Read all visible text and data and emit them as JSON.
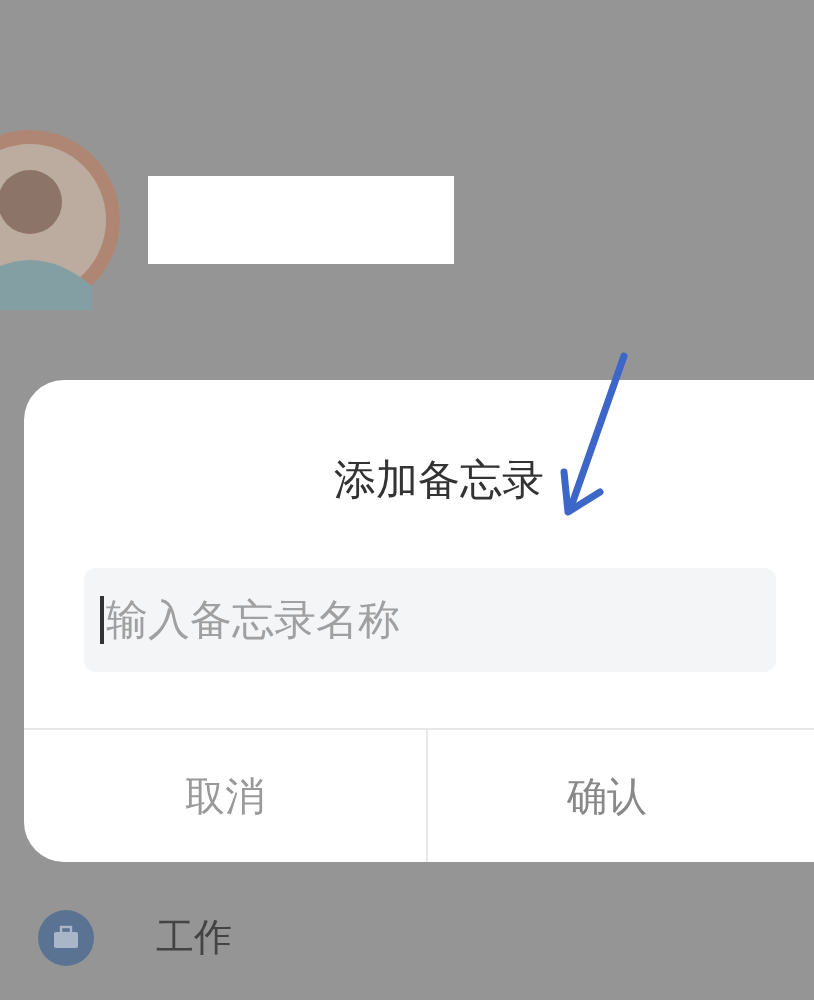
{
  "dialog": {
    "title": "添加备忘录",
    "input": {
      "placeholder": "输入备忘录名称"
    },
    "buttons": [
      {
        "label": "取消",
        "kind": "cancel"
      },
      {
        "label": "确认",
        "kind": "confirm"
      }
    ]
  },
  "menu_items": [
    {
      "label": "工作"
    }
  ]
}
